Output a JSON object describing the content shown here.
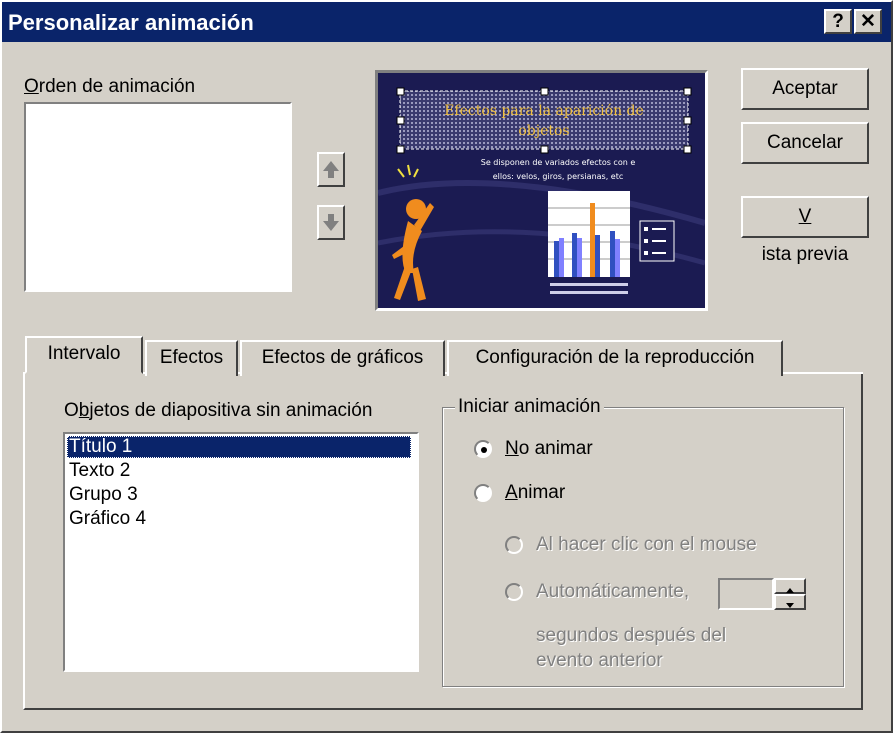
{
  "window": {
    "title": "Personalizar animación",
    "help_label": "?",
    "close_label": "✕"
  },
  "order": {
    "label": "Orden de animación"
  },
  "buttons": {
    "accept": "Aceptar",
    "cancel": "Cancelar",
    "preview": "Vista previa"
  },
  "slide_preview": {
    "title_line1": "Efectos para la aparición de",
    "title_line2": "objetos",
    "body_line1": "Se disponen de variados efectos con e",
    "body_line2": "ellos: velos, giros, persianas, etc"
  },
  "tabs": [
    {
      "label": "Intervalo",
      "active": true
    },
    {
      "label": "Efectos",
      "active": false
    },
    {
      "label": "Efectos de gráficos",
      "active": false
    },
    {
      "label": "Configuración de la reproducción",
      "active": false
    }
  ],
  "objects": {
    "label": "Objetos de diapositiva sin animación",
    "items": [
      "Título 1",
      "Texto 2",
      "Grupo 3",
      "Gráfico 4"
    ],
    "selected_index": 0
  },
  "start_group": {
    "legend": "Iniciar animación",
    "no_animate": "No animar",
    "animate": "Animar",
    "on_click": "Al hacer clic con el mouse",
    "automatic": "Automáticamente,",
    "seconds_line1": "segundos después del",
    "seconds_line2": "evento anterior",
    "selected": "No animar"
  },
  "colors": {
    "titlebar": "#0a246a",
    "selection": "#0a246a",
    "face": "#d4d0c8"
  }
}
